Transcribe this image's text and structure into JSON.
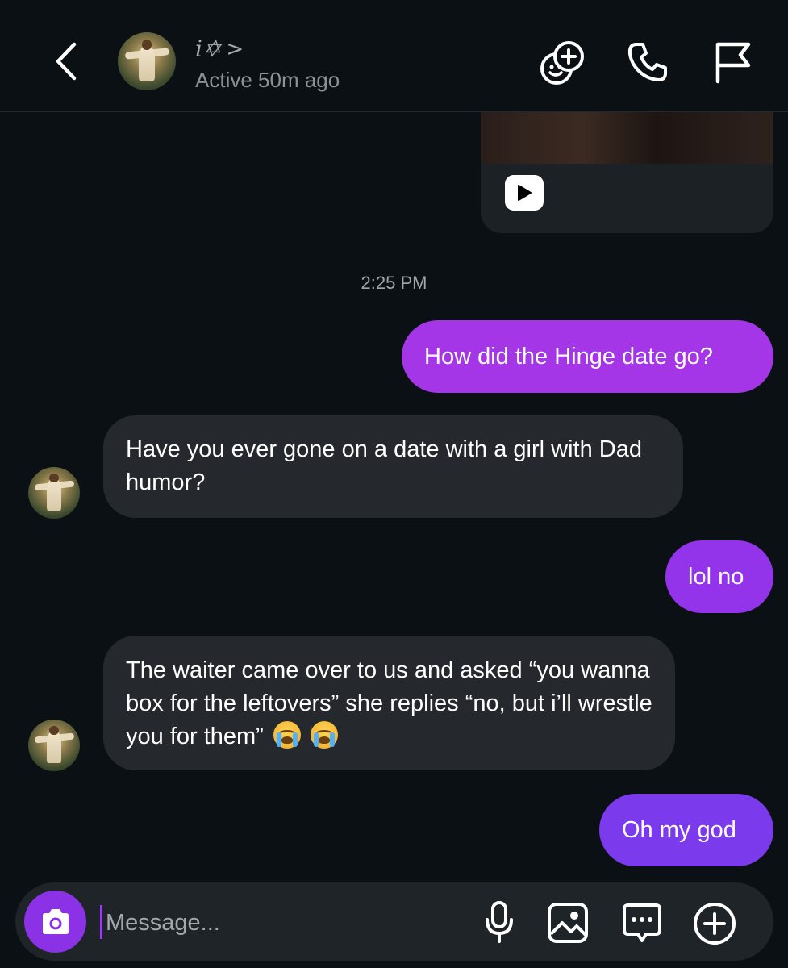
{
  "header": {
    "contact_name": "i✡︎",
    "contact_name_chevron": ">",
    "status": "Active 50m ago"
  },
  "conversation": {
    "timestamp": "2:25 PM",
    "messages": [
      {
        "direction": "outgoing",
        "text": "How did the Hinge date go?"
      },
      {
        "direction": "incoming",
        "text": "Have you ever gone on a date with a girl with Dad humor?"
      },
      {
        "direction": "outgoing",
        "text": "lol no"
      },
      {
        "direction": "incoming",
        "text": "The waiter came over to us and asked “you wanna box for the leftovers” she replies “no, but i’ll wrestle you for them”",
        "emoji": [
          "crying-face",
          "crying-face"
        ]
      },
      {
        "direction": "outgoing",
        "text": "Oh my god"
      }
    ]
  },
  "composer": {
    "placeholder": "Message..."
  },
  "colors": {
    "background": "#0b1014",
    "incoming_bubble": "#25292e",
    "outgoing_bubble_1": "#a436e8",
    "outgoing_bubble_2": "#9333ea",
    "outgoing_bubble_3": "#7c3aed",
    "camera_button": "#8b32e6"
  }
}
